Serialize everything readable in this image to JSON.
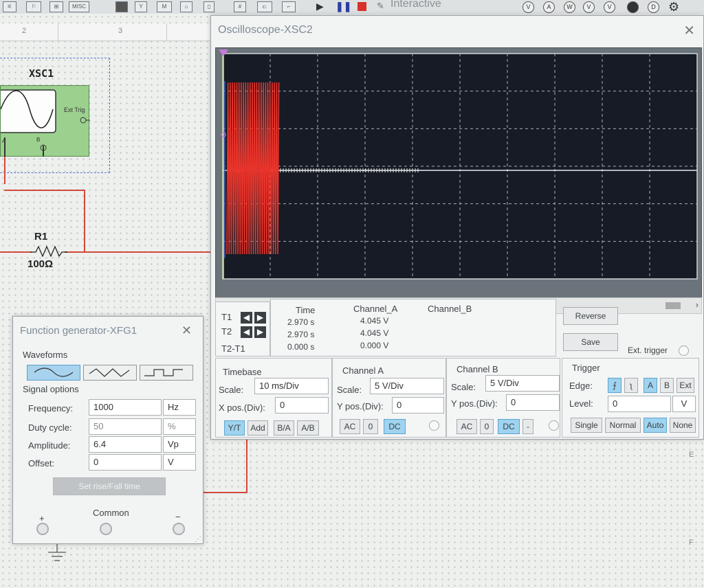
{
  "toolbar": {
    "misc_label": "MISC",
    "interactive_label": "Interactive",
    "meter_icons": [
      "V",
      "A",
      "W",
      "V",
      "V",
      "",
      "D",
      "gear"
    ]
  },
  "workspace": {
    "ruler": [
      "2",
      "3"
    ],
    "row_letters": [
      "E",
      "F"
    ],
    "xsc1_label": "XSC1",
    "ext_trig_label": "Ext Trig",
    "port_a": "A",
    "port_b": "B",
    "r1_label": "R1",
    "r1_value": "100Ω"
  },
  "oscilloscope": {
    "title": "Oscilloscope-XSC2",
    "readout": {
      "headers": [
        "Time",
        "Channel_A",
        "Channel_B"
      ],
      "rows": [
        {
          "label": "T1",
          "time": "2.970 s",
          "channel_a": "4.045 V",
          "channel_b": ""
        },
        {
          "label": "T2",
          "time": "2.970 s",
          "channel_a": "4.045 V",
          "channel_b": ""
        },
        {
          "label": "T2-T1",
          "time": "0.000 s",
          "channel_a": "0.000 V",
          "channel_b": ""
        }
      ]
    },
    "reverse_label": "Reverse",
    "save_label": "Save",
    "ext_trigger_label": "Ext. trigger",
    "timebase": {
      "title": "Timebase",
      "scale_label": "Scale:",
      "scale_value": "10 ms/Div",
      "xpos_label": "X pos.(Div):",
      "xpos_value": "0",
      "buttons": [
        "Y/T",
        "Add",
        "B/A",
        "A/B"
      ],
      "active": "Y/T"
    },
    "channel_a": {
      "title": "Channel A",
      "scale_label": "Scale:",
      "scale_value": "5  V/Div",
      "ypos_label": "Y pos.(Div):",
      "ypos_value": "0",
      "coupling": [
        "AC",
        "0",
        "DC"
      ],
      "active": "DC"
    },
    "channel_b": {
      "title": "Channel B",
      "scale_label": "Scale:",
      "scale_value": "5  V/Div",
      "ypos_label": "Y pos.(Div):",
      "ypos_value": "0",
      "coupling": [
        "AC",
        "0",
        "DC",
        "-"
      ],
      "active": "DC"
    },
    "trigger": {
      "title": "Trigger",
      "edge_label": "Edge:",
      "edge_buttons": [
        "⨍",
        "ʅ",
        "A",
        "B",
        "Ext"
      ],
      "level_label": "Level:",
      "level_value": "0",
      "level_unit": "V",
      "modes": [
        "Single",
        "Normal",
        "Auto",
        "None"
      ],
      "active_mode": "Auto"
    },
    "trace_color": "#e8332a",
    "screen_color": "#161b25"
  },
  "function_generator": {
    "title": "Function generator-XFG1",
    "waveforms_label": "Waveforms",
    "waveforms": [
      "sine-wave",
      "triangle-wave",
      "square-wave"
    ],
    "active_waveform": "sine-wave",
    "signal_options_label": "Signal options",
    "params": [
      {
        "label": "Frequency:",
        "value": "1000",
        "unit": "Hz"
      },
      {
        "label": "Duty cycle:",
        "value": "50",
        "unit": "%"
      },
      {
        "label": "Amplitude:",
        "value": "6.4",
        "unit": "Vp"
      },
      {
        "label": "Offset:",
        "value": "0",
        "unit": "V"
      }
    ],
    "set_rise_fall_label": "Set rise/Fall time",
    "terminals": {
      "plus": "+",
      "common": "Common",
      "minus": "−"
    }
  }
}
